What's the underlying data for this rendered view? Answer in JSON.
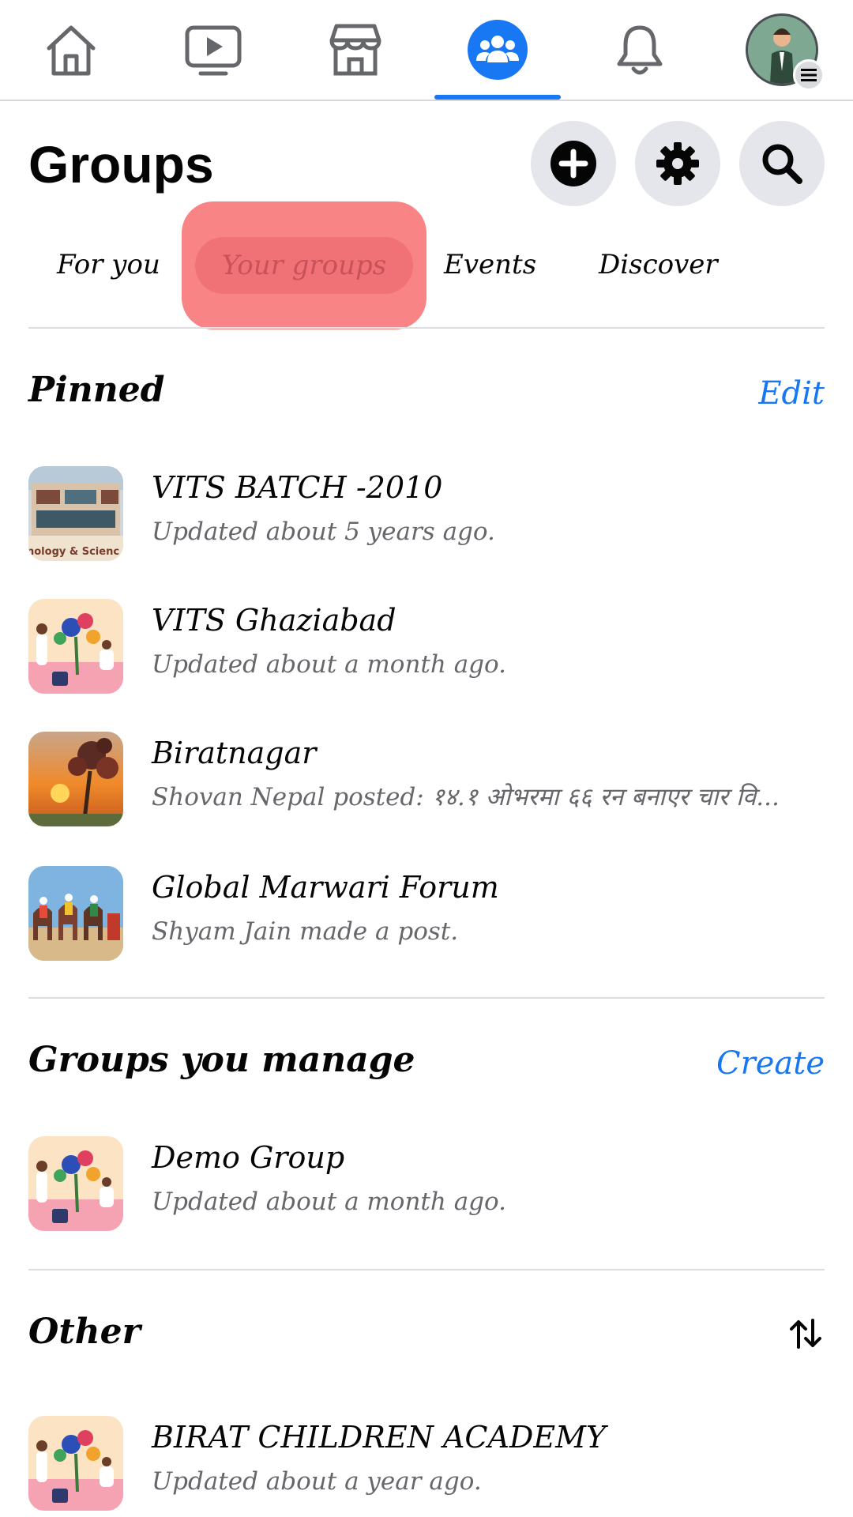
{
  "nav": {
    "items": [
      {
        "name": "home",
        "icon": "home-icon"
      },
      {
        "name": "watch",
        "icon": "video-icon"
      },
      {
        "name": "marketplace",
        "icon": "store-icon"
      },
      {
        "name": "groups",
        "icon": "groups-icon",
        "active": true
      },
      {
        "name": "notifications",
        "icon": "bell-icon"
      },
      {
        "name": "profile",
        "icon": "avatar"
      }
    ],
    "active_color": "#1877f2"
  },
  "header": {
    "title": "Groups",
    "actions": [
      "add-icon",
      "gear-icon",
      "search-icon"
    ]
  },
  "tabs": [
    {
      "label": "For you"
    },
    {
      "label": "Your groups",
      "highlighted": true
    },
    {
      "label": "Events"
    },
    {
      "label": "Discover"
    }
  ],
  "pinned": {
    "title": "Pinned",
    "action": "Edit",
    "groups": [
      {
        "name": "VITS BATCH -2010",
        "subtitle": "Updated about 5 years ago.",
        "thumb_caption": "nology & Scienc"
      },
      {
        "name": "VITS Ghaziabad",
        "subtitle": "Updated about a month ago."
      },
      {
        "name": "Biratnagar",
        "subtitle": "Shovan Nepal posted: १४.१ ओभरमा ६६ रन बनाएर चार वि..."
      },
      {
        "name": "Global Marwari Forum",
        "subtitle": "Shyam Jain made a post."
      }
    ]
  },
  "managed": {
    "title": "Groups you manage",
    "action": "Create",
    "groups": [
      {
        "name": "Demo Group",
        "subtitle": "Updated about a month ago."
      }
    ]
  },
  "other": {
    "title": "Other",
    "sort_icon": "sort-icon",
    "groups": [
      {
        "name": "BIRAT CHILDREN ACADEMY",
        "subtitle": "Updated about a year ago."
      }
    ]
  },
  "colors": {
    "accent": "#1877f2",
    "highlight": "#f98486",
    "secondary_text": "#65676b",
    "button_bg": "#e4e6eb"
  }
}
